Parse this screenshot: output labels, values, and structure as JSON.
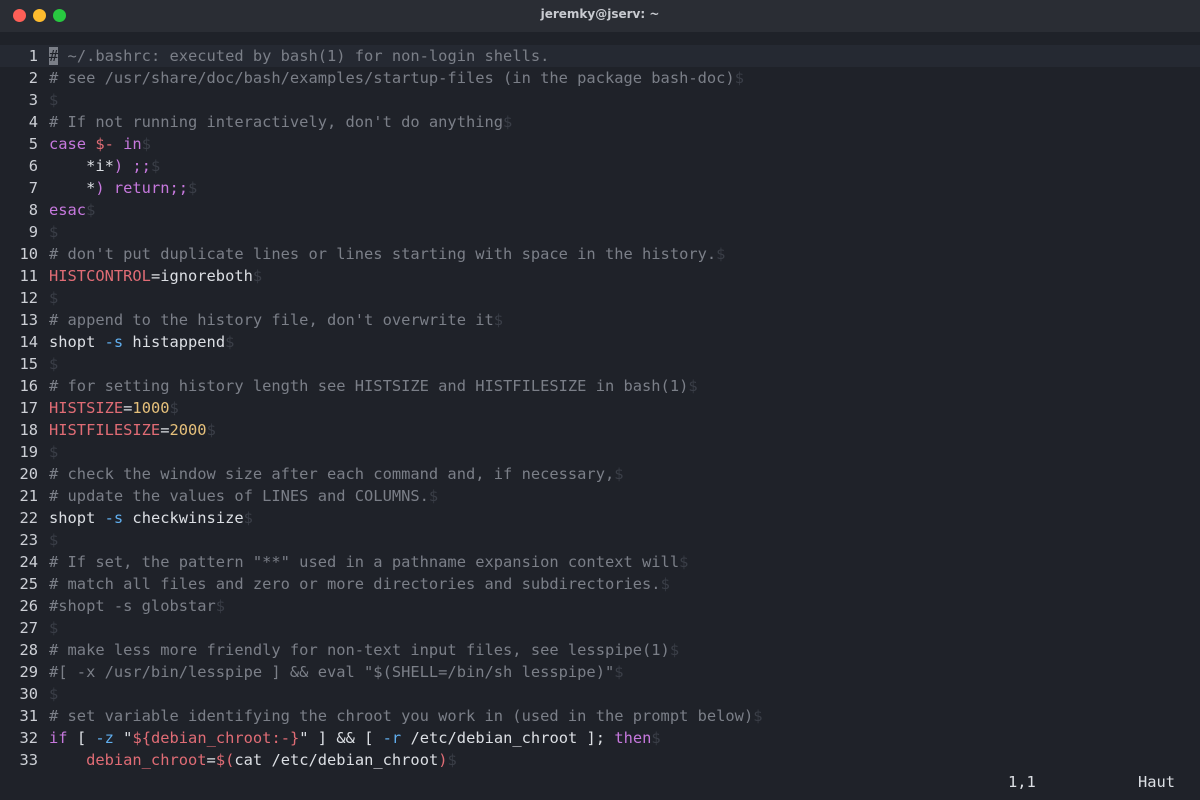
{
  "window": {
    "title": "jeremky@jserv: ~",
    "controls": [
      "close",
      "minimize",
      "zoom"
    ]
  },
  "editor": {
    "lines": [
      {
        "n": "1",
        "tokens": [
          {
            "t": "#",
            "c": "cursor"
          },
          {
            "t": " ~/.bashrc: executed by bash(1) for non-login shells.",
            "c": "comment"
          }
        ]
      },
      {
        "n": "2",
        "tokens": [
          {
            "t": "# see /usr/share/doc/bash/examples/startup-files (in the package bash-doc)",
            "c": "comment"
          },
          {
            "t": "$",
            "c": "eol"
          }
        ]
      },
      {
        "n": "3",
        "tokens": [
          {
            "t": "$",
            "c": "eol"
          }
        ]
      },
      {
        "n": "4",
        "tokens": [
          {
            "t": "# If not running interactively, don't do anything",
            "c": "comment"
          },
          {
            "t": "$",
            "c": "eol"
          }
        ]
      },
      {
        "n": "5",
        "tokens": [
          {
            "t": "case ",
            "c": "keyword"
          },
          {
            "t": "$- ",
            "c": "variable"
          },
          {
            "t": "in",
            "c": "keyword"
          },
          {
            "t": "$",
            "c": "eol"
          }
        ]
      },
      {
        "n": "6",
        "tokens": [
          {
            "t": "    *i*",
            "c": "plain"
          },
          {
            "t": ") ;;",
            "c": "keyword"
          },
          {
            "t": "$",
            "c": "eol"
          }
        ]
      },
      {
        "n": "7",
        "tokens": [
          {
            "t": "    *",
            "c": "plain"
          },
          {
            "t": ") return;;",
            "c": "keyword"
          },
          {
            "t": "$",
            "c": "eol"
          }
        ]
      },
      {
        "n": "8",
        "tokens": [
          {
            "t": "esac",
            "c": "keyword"
          },
          {
            "t": "$",
            "c": "eol"
          }
        ]
      },
      {
        "n": "9",
        "tokens": [
          {
            "t": "$",
            "c": "eol"
          }
        ]
      },
      {
        "n": "10",
        "tokens": [
          {
            "t": "# don't put duplicate lines or lines starting with space in the history.",
            "c": "comment"
          },
          {
            "t": "$",
            "c": "eol"
          }
        ]
      },
      {
        "n": "11",
        "tokens": [
          {
            "t": "HISTCONTROL",
            "c": "variable"
          },
          {
            "t": "=ignoreboth",
            "c": "plain"
          },
          {
            "t": "$",
            "c": "eol"
          }
        ]
      },
      {
        "n": "12",
        "tokens": [
          {
            "t": "$",
            "c": "eol"
          }
        ]
      },
      {
        "n": "13",
        "tokens": [
          {
            "t": "# append to the history file, don't overwrite it",
            "c": "comment"
          },
          {
            "t": "$",
            "c": "eol"
          }
        ]
      },
      {
        "n": "14",
        "tokens": [
          {
            "t": "shopt ",
            "c": "plain"
          },
          {
            "t": "-s",
            "c": "flag"
          },
          {
            "t": " histappend",
            "c": "plain"
          },
          {
            "t": "$",
            "c": "eol"
          }
        ]
      },
      {
        "n": "15",
        "tokens": [
          {
            "t": "$",
            "c": "eol"
          }
        ]
      },
      {
        "n": "16",
        "tokens": [
          {
            "t": "# for setting history length see HISTSIZE and HISTFILESIZE in bash(1)",
            "c": "comment"
          },
          {
            "t": "$",
            "c": "eol"
          }
        ]
      },
      {
        "n": "17",
        "tokens": [
          {
            "t": "HISTSIZE",
            "c": "variable"
          },
          {
            "t": "=",
            "c": "plain"
          },
          {
            "t": "1000",
            "c": "number"
          },
          {
            "t": "$",
            "c": "eol"
          }
        ]
      },
      {
        "n": "18",
        "tokens": [
          {
            "t": "HISTFILESIZE",
            "c": "variable"
          },
          {
            "t": "=",
            "c": "plain"
          },
          {
            "t": "2000",
            "c": "number"
          },
          {
            "t": "$",
            "c": "eol"
          }
        ]
      },
      {
        "n": "19",
        "tokens": [
          {
            "t": "$",
            "c": "eol"
          }
        ]
      },
      {
        "n": "20",
        "tokens": [
          {
            "t": "# check the window size after each command and, if necessary,",
            "c": "comment"
          },
          {
            "t": "$",
            "c": "eol"
          }
        ]
      },
      {
        "n": "21",
        "tokens": [
          {
            "t": "# update the values of LINES and COLUMNS.",
            "c": "comment"
          },
          {
            "t": "$",
            "c": "eol"
          }
        ]
      },
      {
        "n": "22",
        "tokens": [
          {
            "t": "shopt ",
            "c": "plain"
          },
          {
            "t": "-s",
            "c": "flag"
          },
          {
            "t": " checkwinsize",
            "c": "plain"
          },
          {
            "t": "$",
            "c": "eol"
          }
        ]
      },
      {
        "n": "23",
        "tokens": [
          {
            "t": "$",
            "c": "eol"
          }
        ]
      },
      {
        "n": "24",
        "tokens": [
          {
            "t": "# If set, the pattern \"**\" used in a pathname expansion context will",
            "c": "comment"
          },
          {
            "t": "$",
            "c": "eol"
          }
        ]
      },
      {
        "n": "25",
        "tokens": [
          {
            "t": "# match all files and zero or more directories and subdirectories.",
            "c": "comment"
          },
          {
            "t": "$",
            "c": "eol"
          }
        ]
      },
      {
        "n": "26",
        "tokens": [
          {
            "t": "#shopt -s globstar",
            "c": "comment"
          },
          {
            "t": "$",
            "c": "eol"
          }
        ]
      },
      {
        "n": "27",
        "tokens": [
          {
            "t": "$",
            "c": "eol"
          }
        ]
      },
      {
        "n": "28",
        "tokens": [
          {
            "t": "# make less more friendly for non-text input files, see lesspipe(1)",
            "c": "comment"
          },
          {
            "t": "$",
            "c": "eol"
          }
        ]
      },
      {
        "n": "29",
        "tokens": [
          {
            "t": "#[ -x /usr/bin/lesspipe ] && eval \"$(SHELL=/bin/sh lesspipe)\"",
            "c": "comment"
          },
          {
            "t": "$",
            "c": "eol"
          }
        ]
      },
      {
        "n": "30",
        "tokens": [
          {
            "t": "$",
            "c": "eol"
          }
        ]
      },
      {
        "n": "31",
        "tokens": [
          {
            "t": "# set variable identifying the chroot you work in (used in the prompt below)",
            "c": "comment"
          },
          {
            "t": "$",
            "c": "eol"
          }
        ]
      },
      {
        "n": "32",
        "tokens": [
          {
            "t": "if",
            "c": "keyword"
          },
          {
            "t": " [ ",
            "c": "plain"
          },
          {
            "t": "-z",
            "c": "flag"
          },
          {
            "t": " \"",
            "c": "plain"
          },
          {
            "t": "${debian_chroot:-}",
            "c": "variable"
          },
          {
            "t": "\" ] && [ ",
            "c": "plain"
          },
          {
            "t": "-r",
            "c": "flag"
          },
          {
            "t": " /etc/debian_chroot ]; ",
            "c": "plain"
          },
          {
            "t": "then",
            "c": "keyword"
          },
          {
            "t": "$",
            "c": "eol"
          }
        ]
      },
      {
        "n": "33",
        "tokens": [
          {
            "t": "    debian_chroot",
            "c": "variable"
          },
          {
            "t": "=",
            "c": "plain"
          },
          {
            "t": "$(",
            "c": "variable"
          },
          {
            "t": "cat",
            "c": "plain"
          },
          {
            "t": " /etc/debian_chroot",
            "c": "plain"
          },
          {
            "t": ")",
            "c": "variable"
          },
          {
            "t": "$",
            "c": "eol"
          }
        ]
      }
    ]
  },
  "status": {
    "position": "1,1",
    "scroll": "Haut"
  },
  "colors": {
    "background": "#1f2229",
    "comment": "#7b7f88",
    "keyword": "#c678dd",
    "variable": "#e06c75",
    "number": "#e5c07b",
    "flag": "#61afef",
    "plain": "#dcdfe4"
  }
}
